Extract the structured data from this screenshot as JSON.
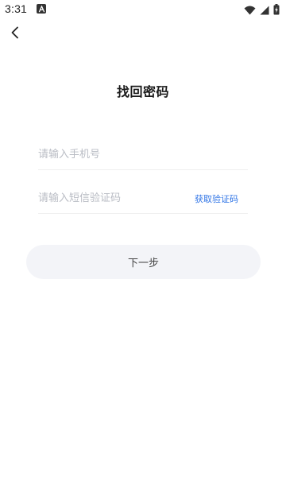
{
  "status_bar": {
    "time": "3:31",
    "icons": [
      "app-a-icon",
      "wifi-icon",
      "cellular-signal-icon",
      "battery-charging-icon"
    ]
  },
  "nav": {
    "back_icon": "chevron-left-icon"
  },
  "page": {
    "title": "找回密码"
  },
  "form": {
    "phone": {
      "placeholder": "请输入手机号",
      "value": ""
    },
    "code": {
      "placeholder": "请输入短信验证码",
      "value": "",
      "get_code_label": "获取验证码"
    },
    "next_label": "下一步"
  },
  "colors": {
    "accent": "#2f74e6",
    "button_bg": "#f3f4f8",
    "placeholder": "#b9bcc4",
    "divider": "#efefef"
  }
}
